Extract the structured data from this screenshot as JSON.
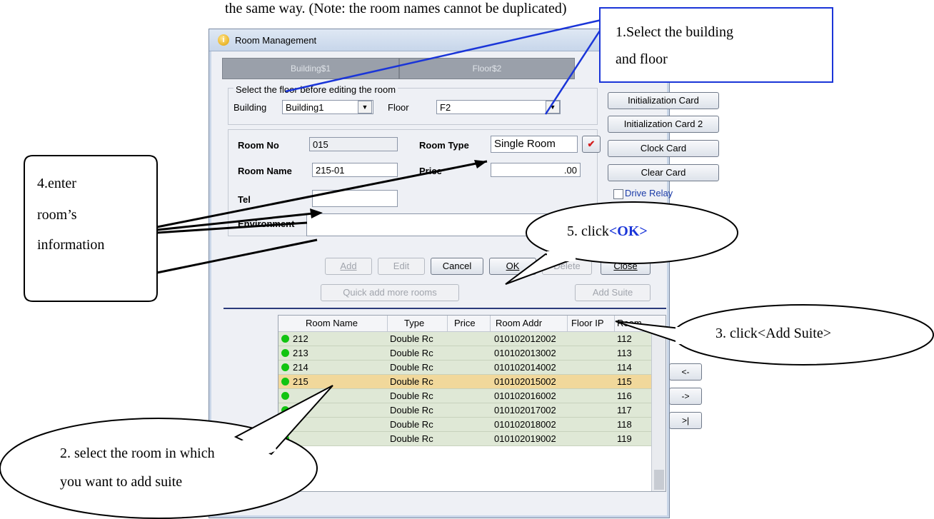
{
  "doc_text": "the same way. (Note: the room names cannot be duplicated)",
  "window": {
    "title": "Room Management",
    "tabs": [
      "Building$1",
      "Floor$2"
    ],
    "floor_group_title": "Select the floor before editing the room",
    "building_label": "Building",
    "building_value": "Building1",
    "floor_label": "Floor",
    "floor_value": "F2",
    "room_no_label": "Room No",
    "room_no_value": "015",
    "room_type_label": "Room Type",
    "room_type_value": "Single Room",
    "room_name_label": "Room Name",
    "room_name_value": "215-01",
    "price_label": "Price",
    "price_value": ".00",
    "tel_label": "Tel",
    "tel_value": "",
    "environment_label": "Environment",
    "environment_value": "",
    "side_buttons": [
      "Initialization Card",
      "Initialization Card 2",
      "Clock Card",
      "Clear Card"
    ],
    "drive_relay_label": "Drive Relay",
    "action_buttons": {
      "add": "Add",
      "edit": "Edit",
      "cancel": "Cancel",
      "ok": "OK",
      "delete": "Delete",
      "close": "Close"
    },
    "quick_add": "Quick add more rooms",
    "add_suite": "Add Suite"
  },
  "grid": {
    "headers": [
      "Room Name",
      "Type",
      "Price",
      "Room Addr",
      "Floor IP",
      "Room"
    ],
    "rows": [
      {
        "name": "212",
        "type": "Double Rc",
        "price": "",
        "addr": "010102012002",
        "room": "112"
      },
      {
        "name": "213",
        "type": "Double Rc",
        "price": "",
        "addr": "010102013002",
        "room": "113"
      },
      {
        "name": "214",
        "type": "Double Rc",
        "price": "",
        "addr": "010102014002",
        "room": "114"
      },
      {
        "name": "215",
        "type": "Double Rc",
        "price": "",
        "addr": "010102015002",
        "room": "115"
      },
      {
        "name": "",
        "type": "Double Rc",
        "price": "",
        "addr": "010102016002",
        "room": "116"
      },
      {
        "name": "",
        "type": "Double Rc",
        "price": "",
        "addr": "010102017002",
        "room": "117"
      },
      {
        "name": "",
        "type": "Double Rc",
        "price": "",
        "addr": "010102018002",
        "room": "118"
      },
      {
        "name": "",
        "type": "Double Rc",
        "price": "",
        "addr": "010102019002",
        "room": "119"
      }
    ],
    "selected_room": "215",
    "nav": [
      "<-",
      "->",
      ">|"
    ]
  },
  "callouts": {
    "c1_line1": "1.Select the building",
    "c1_line2": "and floor",
    "c2_line1": "2. select the room in which",
    "c2_line2": "you want to add suite",
    "c3": "3. click<Add Suite>",
    "c4_line1": "4.enter",
    "c4_line2": "room’s",
    "c4_line3": "information",
    "c5_prefix": "5. click",
    "c5_ok": "<OK>"
  },
  "colors": {
    "callout_border": "#1a35d8",
    "ok_highlight": "#1a35d8",
    "selected_row": "#f1d89b",
    "row_bg": "#dfe8d6",
    "status_dot": "#11c411"
  }
}
